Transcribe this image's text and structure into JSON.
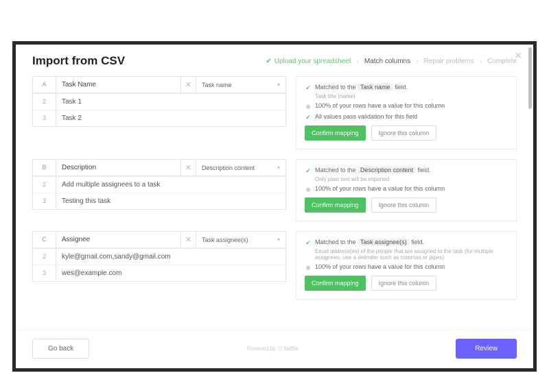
{
  "header": {
    "title": "Import from CSV",
    "steps": [
      {
        "label": "Upload your spreadsheet",
        "state": "done"
      },
      {
        "label": "Match columns",
        "state": "active"
      },
      {
        "label": "Repair problems",
        "state": "pending"
      },
      {
        "label": "Complete",
        "state": "pending"
      }
    ]
  },
  "columns": [
    {
      "letter": "A",
      "source": "Task Name",
      "mapped": "Task name",
      "rows": [
        {
          "n": "2",
          "v": "Task 1"
        },
        {
          "n": "3",
          "v": "Task 2"
        }
      ],
      "facts": [
        {
          "icon": "ok",
          "prefix": "Matched to the ",
          "chip": "Task name",
          "suffix": "  field.",
          "sub": "Task title (name)"
        },
        {
          "icon": "info",
          "text": "100% of your rows have a value for this column"
        },
        {
          "icon": "ok",
          "text": "All values pass validation for this field"
        }
      ],
      "confirm": "Confirm mapping",
      "ignore": "Ignore this column"
    },
    {
      "letter": "B",
      "source": "Description",
      "mapped": "Description content",
      "rows": [
        {
          "n": "2",
          "v": "Add multiple assignees to a task"
        },
        {
          "n": "3",
          "v": "Testing this task"
        }
      ],
      "facts": [
        {
          "icon": "ok",
          "prefix": "Matched to the ",
          "chip": "Description content",
          "suffix": "  field.",
          "sub": "Only plain text will be imported"
        },
        {
          "icon": "info",
          "text": "100% of your rows have a value for this column"
        }
      ],
      "confirm": "Confirm mapping",
      "ignore": "Ignore this column"
    },
    {
      "letter": "C",
      "source": "Assignee",
      "mapped": "Task assignee(s)",
      "rows": [
        {
          "n": "2",
          "v": "kyle@gmail.com,sandy@gmail.com"
        },
        {
          "n": "3",
          "v": "wes@example.com"
        }
      ],
      "facts": [
        {
          "icon": "ok",
          "prefix": "Matched to the ",
          "chip": "Task assignee(s)",
          "suffix": "  field.",
          "sub": "Email address(es) of the people that are assigned to the task (for multiple assignees, use a delimiter such as commas or pipes)"
        },
        {
          "icon": "info",
          "text": "100% of your rows have a value for this column"
        }
      ],
      "confirm": "Confirm mapping",
      "ignore": "Ignore this column"
    }
  ],
  "footer": {
    "back": "Go back",
    "powered": "Powered by ⬡ flatfile",
    "review": "Review"
  }
}
